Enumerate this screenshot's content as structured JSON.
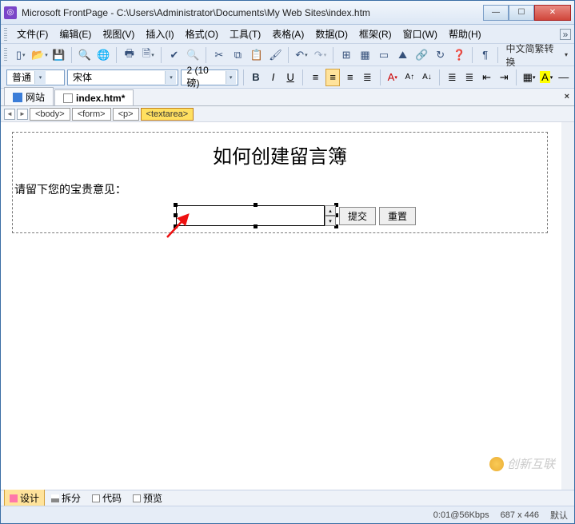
{
  "window": {
    "title": "Microsoft FrontPage - C:\\Users\\Administrator\\Documents\\My Web Sites\\index.htm"
  },
  "menu": {
    "file": "文件(F)",
    "edit": "编辑(E)",
    "view": "视图(V)",
    "insert": "插入(I)",
    "format": "格式(O)",
    "tools": "工具(T)",
    "table": "表格(A)",
    "data": "数据(D)",
    "frame": "框架(R)",
    "window": "窗口(W)",
    "help": "帮助(H)",
    "chevron": "»"
  },
  "toolbar": {
    "ime": "中文简繁转换",
    "ime_dd": "▾"
  },
  "format": {
    "style": "普通",
    "font": "宋体",
    "size": "2 (10 磅)",
    "bold": "B",
    "italic": "I",
    "underline": "U"
  },
  "tabs": {
    "site": "网站",
    "doc": "index.htm*"
  },
  "tags": {
    "body": "<body>",
    "form": "<form>",
    "p": "<p>",
    "textarea": "<textarea>"
  },
  "page": {
    "heading": "如何创建留言簿",
    "prompt": "请留下您的宝贵意见：",
    "submit": "提交",
    "reset": "重置"
  },
  "views": {
    "design": "设计",
    "split": "拆分",
    "code": "代码",
    "preview": "预览"
  },
  "status": {
    "speed": "0:01@56Kbps",
    "res": "687 x 446",
    "mode": "默认"
  },
  "watermark": "创新互联",
  "icons": {
    "new": "▯",
    "open": "📂",
    "save": "💾",
    "search": "🔍",
    "publish": "🌐",
    "print": "🖶",
    "preview": "🗎",
    "spell": "✔",
    "cut": "✂",
    "copy": "⧉",
    "paste": "📋",
    "fmtpaint": "🖌",
    "undo": "↶",
    "redo": "↷",
    "web": "⊞",
    "table": "▦",
    "layer": "▭",
    "pic": "⛰",
    "link": "🔗",
    "refresh": "↻",
    "help": "❓",
    "show": "¶",
    "al": "≡",
    "ac": "≡",
    "ar": "≡",
    "aj": "≣",
    "fclr": "A",
    "hl": "A",
    "numlist": "≣",
    "bullist": "≣",
    "out": "⇤",
    "in": "⇥",
    "bord": "▦",
    "line": "—"
  }
}
